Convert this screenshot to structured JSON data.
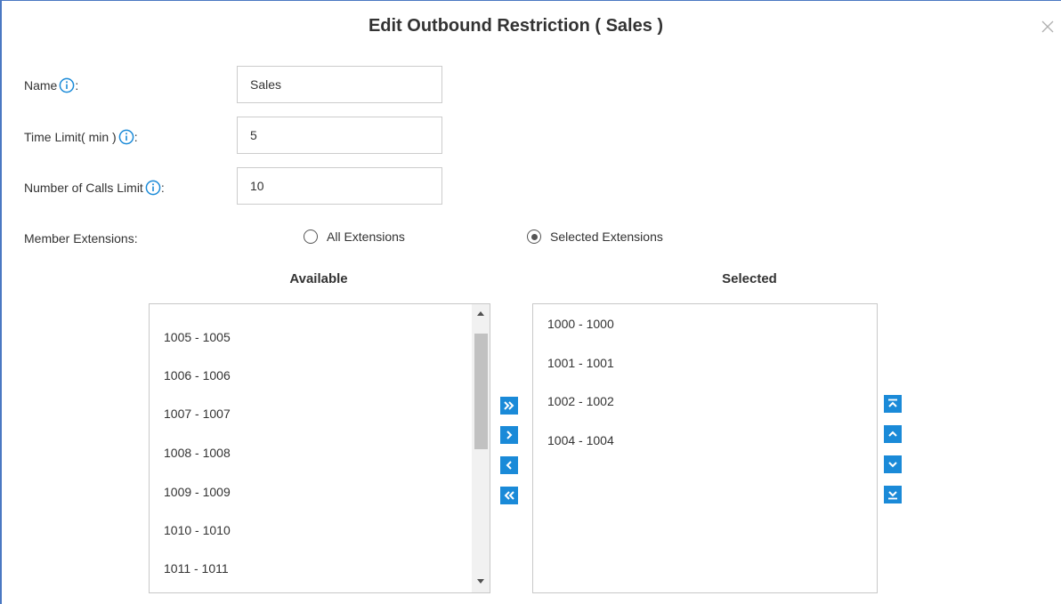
{
  "dialog": {
    "title": "Edit Outbound Restriction ( Sales )"
  },
  "form": {
    "name": {
      "label": "Name",
      "suffix": ":",
      "value": "Sales"
    },
    "time_limit": {
      "label": "Time Limit( min )",
      "suffix": ":",
      "value": "5"
    },
    "calls_limit": {
      "label": "Number of Calls Limit",
      "suffix": ":",
      "value": "10"
    },
    "member_extensions": {
      "label": "Member Extensions:",
      "options": [
        {
          "label": "All Extensions",
          "checked": false
        },
        {
          "label": "Selected Extensions",
          "checked": true
        }
      ]
    }
  },
  "available": {
    "heading": "Available",
    "items": [
      "1005 - 1005",
      "1006 - 1006",
      "1007 - 1007",
      "1008 - 1008",
      "1009 - 1009",
      "1010 - 1010",
      "1011 - 1011"
    ]
  },
  "selected": {
    "heading": "Selected",
    "items": [
      "1000 - 1000",
      "1001 - 1001",
      "1002 - 1002",
      "1004 - 1004"
    ]
  },
  "icons": {
    "close": "close-icon",
    "info": "info-icon",
    "move_all_right": "double-chevron-right-icon",
    "move_right": "chevron-right-icon",
    "move_left": "chevron-left-icon",
    "move_all_left": "double-chevron-left-icon",
    "move_top": "move-to-top-icon",
    "move_up": "chevron-up-icon",
    "move_down": "chevron-down-icon",
    "move_bottom": "move-to-bottom-icon"
  },
  "colors": {
    "accent": "#1a8ad8",
    "dialog_border": "#4a78c2",
    "text": "#333333"
  }
}
